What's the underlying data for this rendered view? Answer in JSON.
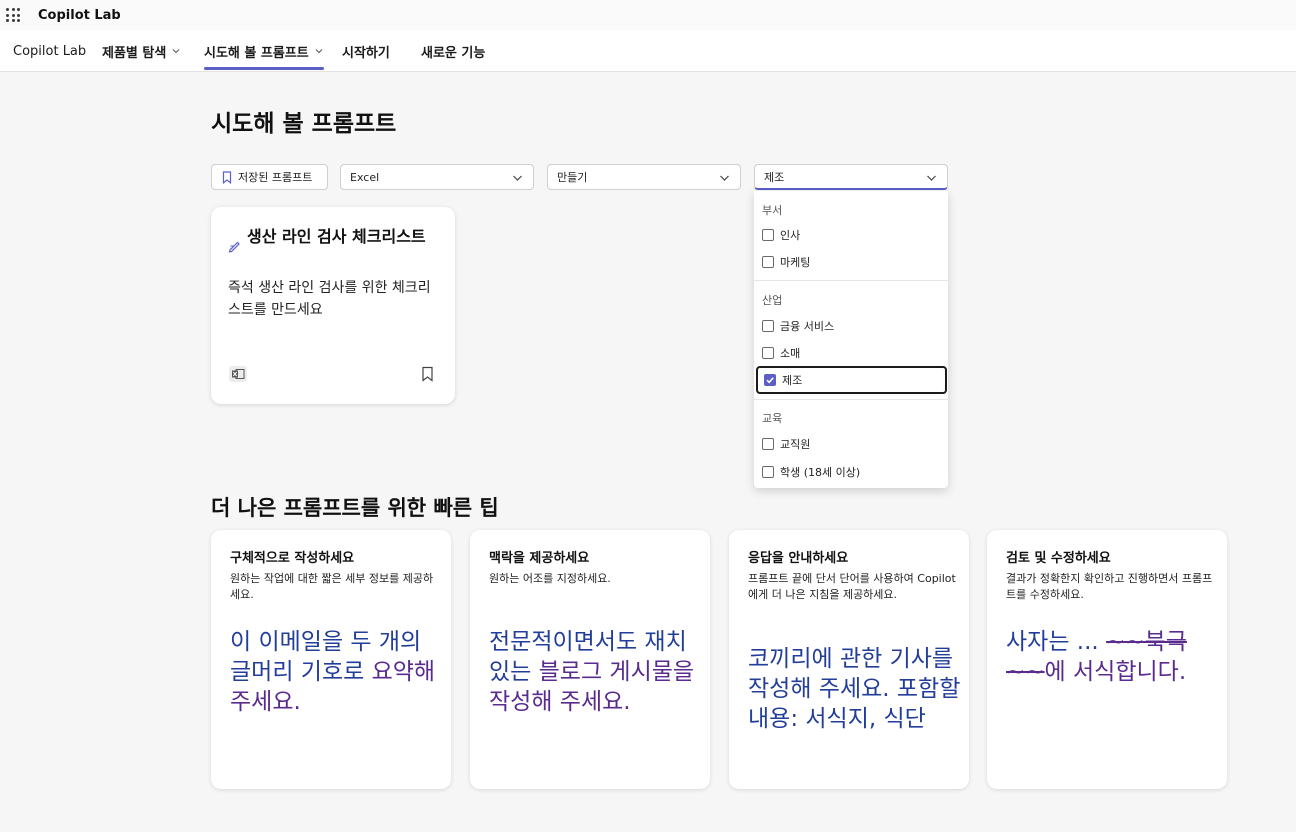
{
  "app": {
    "title": "Copilot Lab"
  },
  "nav": {
    "items": [
      {
        "label": "Copilot Lab"
      },
      {
        "label": "제품별 탐색"
      },
      {
        "label": "시도해 볼 프롬프트"
      },
      {
        "label": "시작하기"
      },
      {
        "label": "새로운 기능"
      }
    ]
  },
  "page": {
    "title": "시도해 볼 프롬프트"
  },
  "filters": {
    "saved_label": "저장된 프롬프트",
    "product": "Excel",
    "task": "만들기",
    "role": "제조"
  },
  "prompt_card": {
    "title": "생산 라인 검사 체크리스트",
    "description": "즉석 생산 라인 검사를 위한 체크리스트를 만드세요"
  },
  "dropdown": {
    "groups": [
      {
        "label": "부서",
        "options": [
          {
            "label": "인사",
            "checked": false
          },
          {
            "label": "마케팅",
            "checked": false
          }
        ]
      },
      {
        "label": "산업",
        "options": [
          {
            "label": "금융 서비스",
            "checked": false
          },
          {
            "label": "소매",
            "checked": false
          },
          {
            "label": "제조",
            "checked": true
          }
        ]
      },
      {
        "label": "교육",
        "options": [
          {
            "label": "교직원",
            "checked": false
          },
          {
            "label": "학생 (18세 이상)",
            "checked": false
          }
        ]
      }
    ]
  },
  "tips": {
    "title": "더 나은 프롬프트를 위한 빠른 팁",
    "cards": [
      {
        "title": "구체적으로 작성하세요",
        "description": "원하는 작업에 대한 짧은 세부 정보를 제공하세요.",
        "example_a": "이 이메일을 두 개의 글머리 기호로 ",
        "example_b": "요약해 주세요."
      },
      {
        "title": "맥락을 제공하세요",
        "description": "원하는 어조를 지정하세요.",
        "example_a": "전문적이면서도 재치 있는 ",
        "example_b": "블로그 게시물을 작성해 주세요."
      },
      {
        "title": "응답을 안내하세요",
        "description": "프롬프트 끝에 단서 단어를 사용하여 Copilot에게 더 나은 지침을 제공하세요.",
        "example_a": "코끼리에 관한 기사를 작성해 주세요. 포함할 내용: 서식지, 식단",
        "example_b": ""
      },
      {
        "title": "검토 및 수정하세요",
        "description": "결과가 정확한지 확인하고 진행하면서 프롬프트를 수정하세요.",
        "example_a": "사자는 ... ",
        "example_b": "~~북극~~",
        "example_c": "에 서식합니다."
      }
    ]
  },
  "colors": {
    "accent": "#5b5fc7",
    "example_blue": "#223d9a",
    "example_purple": "#5a2b8f"
  }
}
